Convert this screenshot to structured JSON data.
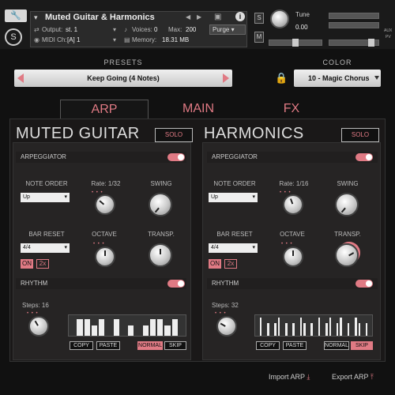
{
  "header": {
    "instrument_title": "Muted Guitar & Harmonics",
    "output_label": "Output:",
    "output_value": "st. 1",
    "midi_label": "MIDI Ch:",
    "midi_value": "[A] 1",
    "voices_label": "Voices:",
    "voices_value": "0",
    "max_label": "Max:",
    "max_value": "200",
    "purge_label": "Purge",
    "memory_label": "Memory:",
    "memory_value": "18.31 MB",
    "s_label": "S",
    "m_label": "M",
    "tune_label": "Tune",
    "tune_value": "0.00",
    "aux_label": "AUX",
    "pv_label": "PV"
  },
  "presets": {
    "label": "PRESETS",
    "value": "Keep Going (4 Notes)"
  },
  "color": {
    "label": "COLOR",
    "value": "10 - Magic Chorus"
  },
  "tabs": [
    {
      "label": "ARP",
      "active": true
    },
    {
      "label": "MAIN",
      "active": false
    },
    {
      "label": "FX",
      "active": false
    }
  ],
  "panels": [
    {
      "title": "MUTED GUITAR",
      "solo": "SOLO",
      "arp_header": "ARPEGGIATOR",
      "note_order_label": "NOTE ORDER",
      "note_order_value": "Up",
      "rate_label": "Rate: 1/32",
      "swing_label": "SWING",
      "bar_reset_label": "BAR RESET",
      "bar_reset_value": "4/4",
      "octave_label": "OCTAVE",
      "transp_label": "TRANSP.",
      "on_label": "ON",
      "x2_label": "2x",
      "rhythm_header": "RHYTHM",
      "steps_label": "Steps: 16",
      "copy": "COPY",
      "paste": "PASTE",
      "normal": "NORMAL",
      "skip": "SKIP",
      "mode_active": "normal",
      "steps": [
        0,
        0.8,
        0.8,
        0.5,
        0.8,
        0,
        0.8,
        0,
        0.5,
        0,
        0.5,
        0.8,
        0.8,
        0.5,
        0.8,
        0
      ]
    },
    {
      "title": "HARMONICS",
      "solo": "SOLO",
      "arp_header": "ARPEGGIATOR",
      "note_order_label": "NOTE ORDER",
      "note_order_value": "Up",
      "rate_label": "Rate: 1/16",
      "swing_label": "SWING",
      "bar_reset_label": "BAR RESET",
      "bar_reset_value": "4/4",
      "octave_label": "OCTAVE",
      "transp_label": "TRANSP.",
      "on_label": "ON",
      "x2_label": "2x",
      "rhythm_header": "RHYTHM",
      "steps_label": "Steps: 32",
      "copy": "COPY",
      "paste": "PASTE",
      "normal": "NORMAL",
      "skip": "SKIP",
      "mode_active": "skip",
      "steps": [
        0,
        0.9,
        0,
        0.6,
        0,
        0.6,
        0.9,
        0,
        0.6,
        0,
        0.6,
        0,
        0.9,
        0.6,
        0,
        0.6,
        0,
        0.9,
        0,
        0.6,
        0.9,
        0,
        0.6,
        0.9,
        0,
        0.6,
        0,
        0.9,
        0.6,
        0,
        0.6,
        0
      ]
    }
  ],
  "footer": {
    "import_label": "Import ARP",
    "export_label": "Export ARP"
  },
  "accent": "#e07a84"
}
